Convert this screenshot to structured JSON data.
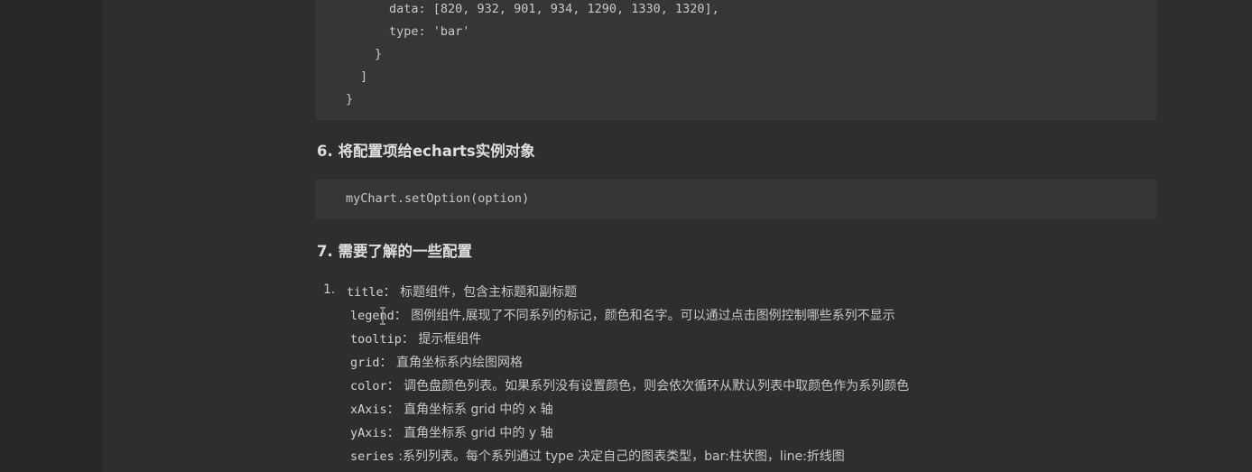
{
  "code_top": {
    "lines": [
      "data: [820, 932, 901, 934, 1290, 1330, 1320],",
      "type: 'bar'",
      "}",
      "]",
      "}"
    ]
  },
  "section6": {
    "heading": "6. 将配置项给echarts实例对象",
    "code": "myChart.setOption(option)"
  },
  "section7": {
    "heading": "7. 需要了解的一些配置",
    "list_number": "1.",
    "items": [
      {
        "key": "title",
        "desc": "： 标题组件，包含主标题和副标题"
      },
      {
        "key": "legend",
        "desc": "： 图例组件,展现了不同系列的标记，颜色和名字。可以通过点击图例控制哪些系列不显示"
      },
      {
        "key": "tooltip",
        "desc": "： 提示框组件"
      },
      {
        "key": "grid",
        "desc": "： 直角坐标系内绘图网格"
      },
      {
        "key": "color",
        "desc": "： 调色盘颜色列表。如果系列没有设置颜色，则会依次循环从默认列表中取颜色作为系列颜色"
      },
      {
        "key": "xAxis",
        "desc": "： 直角坐标系 grid 中的 x 轴"
      },
      {
        "key": "yAxis",
        "desc": "： 直角坐标系 grid 中的 y 轴"
      },
      {
        "key": "series",
        "desc": " :系列列表。每个系列通过 type 决定自己的图表类型，bar:柱状图，line:折线图"
      }
    ]
  },
  "icons": {
    "cursor": "text-cursor-icon"
  },
  "colors": {
    "background": "#2e2e30",
    "code_bg": "#363638",
    "text": "#cfcfcf"
  }
}
